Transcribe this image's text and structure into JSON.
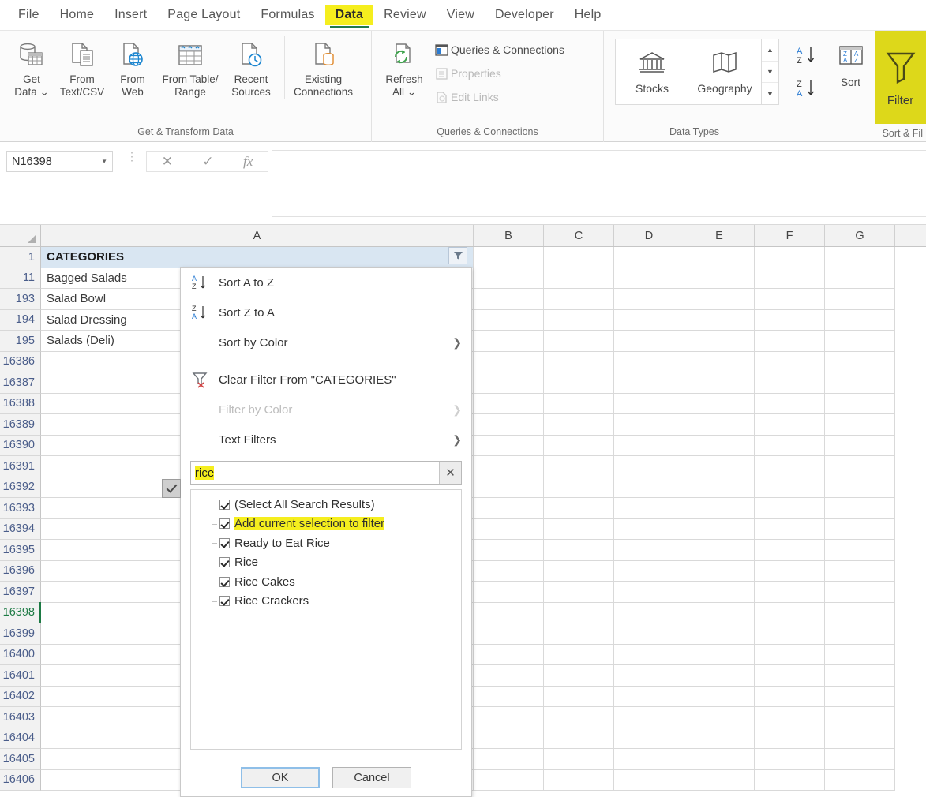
{
  "ribbon": {
    "tabs": [
      {
        "label": "File",
        "active": false
      },
      {
        "label": "Home",
        "active": false
      },
      {
        "label": "Insert",
        "active": false
      },
      {
        "label": "Page Layout",
        "active": false
      },
      {
        "label": "Formulas",
        "active": false
      },
      {
        "label": "Data",
        "active": true
      },
      {
        "label": "Review",
        "active": false
      },
      {
        "label": "View",
        "active": false
      },
      {
        "label": "Developer",
        "active": false
      },
      {
        "label": "Help",
        "active": false
      }
    ],
    "groups": {
      "get_transform": {
        "label": "Get & Transform Data",
        "buttons": [
          {
            "label": "Get\nData ⌄",
            "icon": "get-data-icon"
          },
          {
            "label": "From\nText/CSV",
            "icon": "from-text-csv-icon"
          },
          {
            "label": "From\nWeb",
            "icon": "from-web-icon"
          },
          {
            "label": "From Table/\nRange",
            "icon": "from-table-range-icon"
          },
          {
            "label": "Recent\nSources",
            "icon": "recent-sources-icon"
          },
          {
            "label": "Existing\nConnections",
            "icon": "existing-connections-icon"
          }
        ]
      },
      "queries": {
        "label": "Queries & Connections",
        "refresh_label": "Refresh\nAll ⌄",
        "items": [
          {
            "label": "Queries & Connections",
            "disabled": false
          },
          {
            "label": "Properties",
            "disabled": true
          },
          {
            "label": "Edit Links",
            "disabled": true
          }
        ]
      },
      "data_types": {
        "label": "Data Types",
        "items": [
          {
            "label": "Stocks",
            "icon": "bank-icon"
          },
          {
            "label": "Geography",
            "icon": "map-icon"
          }
        ]
      },
      "sort_filter": {
        "label": "Sort & Fil",
        "sort_label": "Sort",
        "filter_label": "Filter",
        "filter_highlighted": true
      }
    }
  },
  "formula_bar": {
    "name_box": "N16398",
    "cancel_icon": "✕",
    "enter_icon": "✓",
    "function_icon": "fx",
    "value": ""
  },
  "grid": {
    "columns": [
      "A",
      "B",
      "C",
      "D",
      "E",
      "F",
      "G"
    ],
    "header_cell": "CATEGORIES",
    "rows": [
      {
        "num": "1",
        "value": "CATEGORIES",
        "header": true,
        "selected": false
      },
      {
        "num": "11",
        "value": "Bagged Salads",
        "header": false,
        "selected": false
      },
      {
        "num": "193",
        "value": "Salad Bowl",
        "header": false,
        "selected": false
      },
      {
        "num": "194",
        "value": "Salad Dressing",
        "header": false,
        "selected": false
      },
      {
        "num": "195",
        "value": "Salads (Deli)",
        "header": false,
        "selected": false
      },
      {
        "num": "16386",
        "value": "",
        "header": false,
        "selected": false
      },
      {
        "num": "16387",
        "value": "",
        "header": false,
        "selected": false
      },
      {
        "num": "16388",
        "value": "",
        "header": false,
        "selected": false
      },
      {
        "num": "16389",
        "value": "",
        "header": false,
        "selected": false
      },
      {
        "num": "16390",
        "value": "",
        "header": false,
        "selected": false
      },
      {
        "num": "16391",
        "value": "",
        "header": false,
        "selected": false
      },
      {
        "num": "16392",
        "value": "",
        "header": false,
        "selected": false
      },
      {
        "num": "16393",
        "value": "",
        "header": false,
        "selected": false
      },
      {
        "num": "16394",
        "value": "",
        "header": false,
        "selected": false
      },
      {
        "num": "16395",
        "value": "",
        "header": false,
        "selected": false
      },
      {
        "num": "16396",
        "value": "",
        "header": false,
        "selected": false
      },
      {
        "num": "16397",
        "value": "",
        "header": false,
        "selected": false
      },
      {
        "num": "16398",
        "value": "",
        "header": false,
        "selected": true
      },
      {
        "num": "16399",
        "value": "",
        "header": false,
        "selected": false
      },
      {
        "num": "16400",
        "value": "",
        "header": false,
        "selected": false
      },
      {
        "num": "16401",
        "value": "",
        "header": false,
        "selected": false
      },
      {
        "num": "16402",
        "value": "",
        "header": false,
        "selected": false
      },
      {
        "num": "16403",
        "value": "",
        "header": false,
        "selected": false
      },
      {
        "num": "16404",
        "value": "",
        "header": false,
        "selected": false
      },
      {
        "num": "16405",
        "value": "",
        "header": false,
        "selected": false
      },
      {
        "num": "16406",
        "value": "",
        "header": false,
        "selected": false
      }
    ]
  },
  "filter_menu": {
    "items": [
      {
        "label": "Sort A to Z",
        "icon": "sort-az-icon",
        "disabled": false,
        "submenu": false
      },
      {
        "label": "Sort Z to A",
        "icon": "sort-za-icon",
        "disabled": false,
        "submenu": false
      },
      {
        "label": "Sort by Color",
        "icon": "",
        "disabled": false,
        "submenu": true
      },
      {
        "label": "Clear Filter From \"CATEGORIES\"",
        "icon": "clear-filter-icon",
        "disabled": false,
        "submenu": false
      },
      {
        "label": "Filter by Color",
        "icon": "",
        "disabled": true,
        "submenu": true
      },
      {
        "label": "Text Filters",
        "icon": "",
        "disabled": false,
        "submenu": true
      }
    ],
    "search": {
      "value": "rice",
      "highlighted": true,
      "clear_icon": "✕"
    },
    "options": [
      {
        "label": "(Select All Search Results)",
        "checked": true,
        "highlighted": false
      },
      {
        "label": "Add current selection to filter",
        "checked": true,
        "highlighted": true
      },
      {
        "label": "Ready to Eat Rice",
        "checked": true,
        "highlighted": false
      },
      {
        "label": "Rice",
        "checked": true,
        "highlighted": false
      },
      {
        "label": "Rice Cakes",
        "checked": true,
        "highlighted": false
      },
      {
        "label": "Rice Crackers",
        "checked": true,
        "highlighted": false
      }
    ],
    "buttons": {
      "ok": "OK",
      "cancel": "Cancel"
    }
  },
  "colors": {
    "highlight_yellow": "#f5ee1e",
    "tab_underline_green": "#1f7a4d",
    "header_fill": "#d9e6f2",
    "selected_row_green": "#1d7a44"
  }
}
